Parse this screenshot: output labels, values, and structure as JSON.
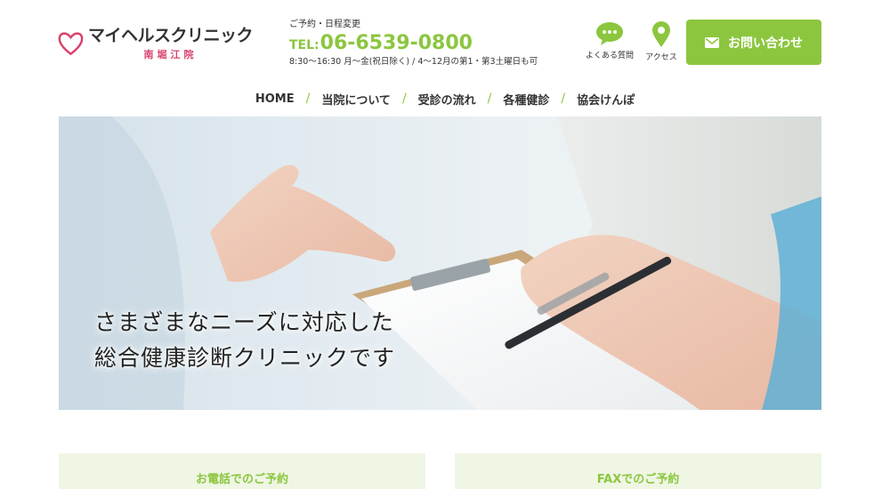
{
  "logo": {
    "name": "マイヘルスクリニック",
    "branch": "南堀江院",
    "mark_color": "#d9436b"
  },
  "contact": {
    "label": "ご予約・日程変更",
    "tel_prefix": "TEL:",
    "tel_number": "06-6539-0800",
    "hours": "8:30〜16:30 月〜金(祝日除く) / 4〜12月の第1・第3土曜日も可",
    "accent_color": "#8cc63f"
  },
  "utility": {
    "faq_label": "よくある質問",
    "faq_icon": "chat-bubble-icon",
    "access_label": "アクセス",
    "access_icon": "map-pin-icon"
  },
  "inquiry_button": {
    "label": "お問い合わせ",
    "icon": "mail-icon",
    "color": "#8cc63f"
  },
  "nav": {
    "items": [
      "HOME",
      "当院について",
      "受診の流れ",
      "各種健診",
      "協会けんぽ"
    ],
    "separator": "/"
  },
  "hero": {
    "line1": "さまざまなニーズに対応した",
    "line2": "総合健康診断クリニックです"
  },
  "cards": {
    "phone_title": "お電話でのご予約",
    "fax_title": "FAXでのご予約",
    "background": "#eff6e4"
  }
}
